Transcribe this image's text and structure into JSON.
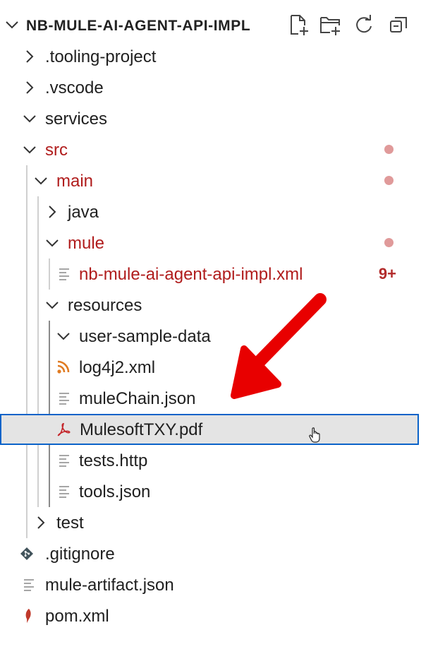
{
  "explorer": {
    "project_title": "NB-MULE-AI-AGENT-API-IMPL",
    "actions": [
      {
        "name": "new-file-icon"
      },
      {
        "name": "new-folder-icon"
      },
      {
        "name": "refresh-icon"
      },
      {
        "name": "collapse-all-icon"
      }
    ]
  },
  "tree": {
    "items": [
      {
        "label": ".tooling-project",
        "type": "folder",
        "state": "collapsed"
      },
      {
        "label": ".vscode",
        "type": "folder",
        "state": "collapsed"
      },
      {
        "label": "services",
        "type": "folder",
        "state": "expanded"
      },
      {
        "label": "src",
        "type": "folder",
        "state": "expanded",
        "modified": true
      },
      {
        "label": "main",
        "type": "folder",
        "state": "expanded",
        "modified": true
      },
      {
        "label": "java",
        "type": "folder",
        "state": "collapsed"
      },
      {
        "label": "mule",
        "type": "folder",
        "state": "expanded",
        "modified": true
      },
      {
        "label": "nb-mule-ai-agent-api-impl.xml",
        "type": "file",
        "badge": "9+",
        "modified": true
      },
      {
        "label": "resources",
        "type": "folder",
        "state": "expanded"
      },
      {
        "label": "user-sample-data",
        "type": "folder",
        "state": "expanded"
      },
      {
        "label": "log4j2.xml",
        "type": "file",
        "icon": "rss-icon"
      },
      {
        "label": "muleChain.json",
        "type": "file",
        "icon": "lines-file-icon"
      },
      {
        "label": "MulesoftTXY.pdf",
        "type": "file",
        "icon": "pdf-icon",
        "selected": true
      },
      {
        "label": "tests.http",
        "type": "file",
        "icon": "lines-file-icon"
      },
      {
        "label": "tools.json",
        "type": "file",
        "icon": "lines-file-icon"
      },
      {
        "label": "test",
        "type": "folder",
        "state": "collapsed"
      },
      {
        "label": ".gitignore",
        "type": "file",
        "icon": "git-icon"
      },
      {
        "label": "mule-artifact.json",
        "type": "file",
        "icon": "lines-file-icon"
      },
      {
        "label": "pom.xml",
        "type": "file",
        "icon": "maven-feather-icon"
      }
    ]
  },
  "colors": {
    "modified_text": "#b01c1c",
    "modified_dot": "#e09a9a",
    "selection_border": "#0b63c9",
    "selection_bg": "#e4e4e4",
    "annotation_arrow": "#e80000"
  }
}
